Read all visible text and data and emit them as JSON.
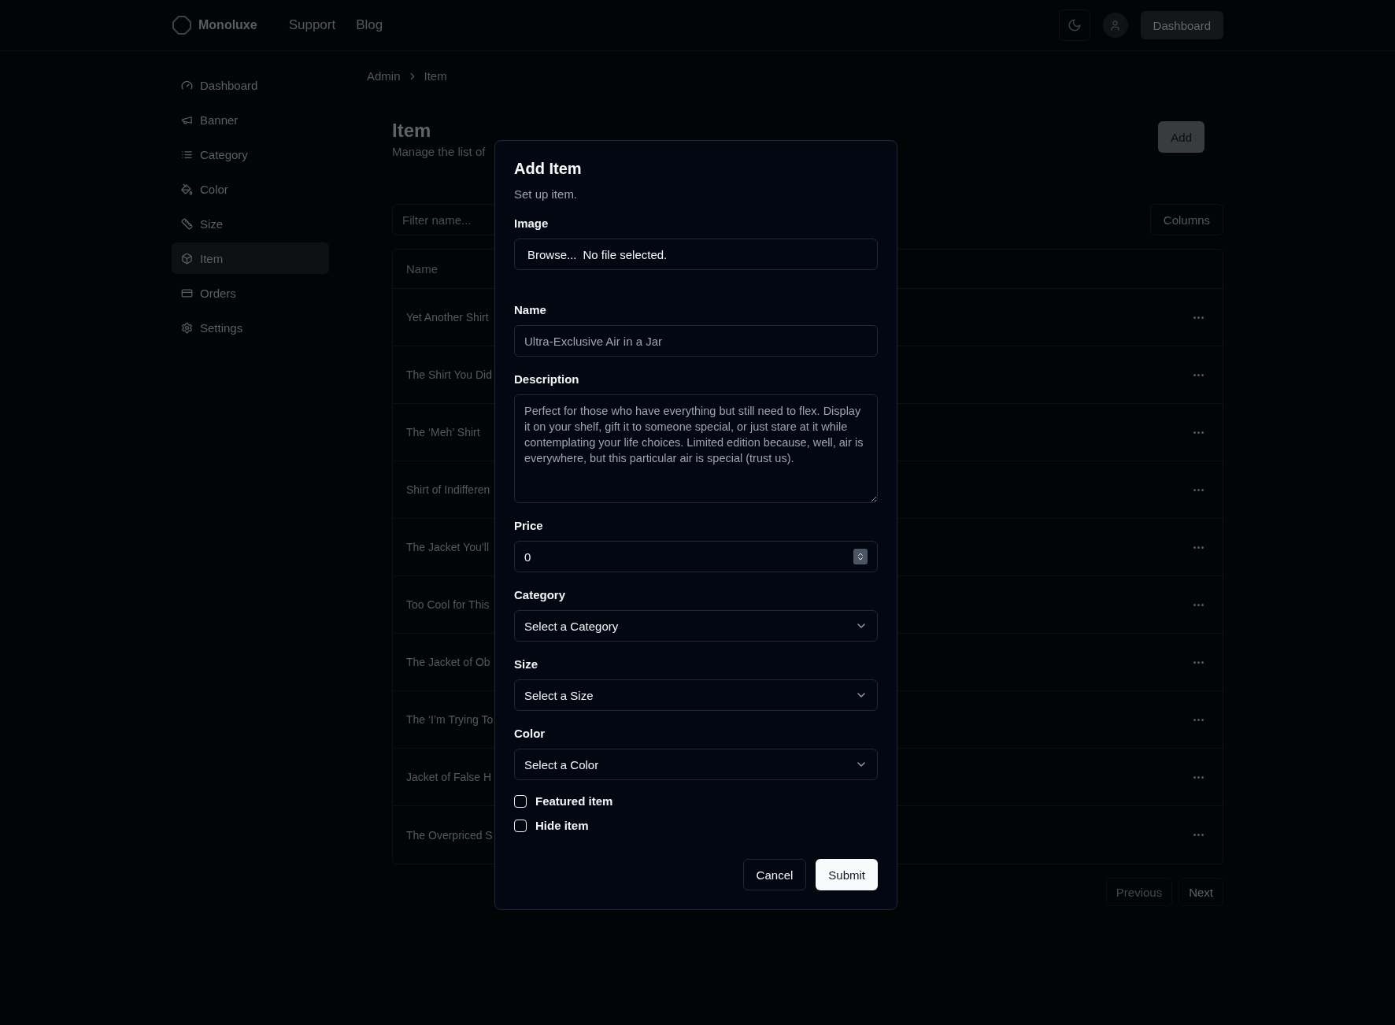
{
  "header": {
    "brand": "Monoluxe",
    "nav": [
      "Support",
      "Blog"
    ],
    "dashboard_button": "Dashboard"
  },
  "sidebar": {
    "items": [
      {
        "label": "Dashboard",
        "selected": false
      },
      {
        "label": "Banner",
        "selected": false
      },
      {
        "label": "Category",
        "selected": false
      },
      {
        "label": "Color",
        "selected": false
      },
      {
        "label": "Size",
        "selected": false
      },
      {
        "label": "Item",
        "selected": true
      },
      {
        "label": "Orders",
        "selected": false
      },
      {
        "label": "Settings",
        "selected": false
      }
    ]
  },
  "breadcrumb": [
    "Admin",
    "Item"
  ],
  "page": {
    "title": "Item",
    "subtitle": "Manage the list of",
    "add_button": "Add"
  },
  "filter": {
    "placeholder": "Filter name..."
  },
  "columns_button": "Columns",
  "table": {
    "columns": [
      "Name"
    ],
    "rows": [
      "Yet Another Shirt",
      "The Shirt You Did",
      "The ‘Meh’ Shirt",
      "Shirt of Indifferen",
      "The Jacket You’ll",
      "Too Cool for This",
      "The Jacket of Ob",
      "The ‘I’m Trying To",
      "Jacket of False H",
      "The Overpriced S"
    ]
  },
  "pagination": {
    "previous": "Previous",
    "next": "Next"
  },
  "dialog": {
    "title": "Add Item",
    "subtitle": "Set up item.",
    "fields": [
      {
        "kind": "file",
        "label": "Image",
        "button": "Browse...",
        "value": "No file selected."
      },
      {
        "kind": "text",
        "label": "Name",
        "placeholder": "Ultra-Exclusive Air in a Jar"
      },
      {
        "kind": "textarea",
        "label": "Description",
        "placeholder": "Perfect for those who have everything but still need to flex. Display it on your shelf, gift it to someone special, or just stare at it while contemplating your life choices. Limited edition because, well, air is everywhere, but this particular air is special (trust us)."
      },
      {
        "kind": "number",
        "label": "Price",
        "value": "0"
      },
      {
        "kind": "select",
        "label": "Category",
        "value": "Select a Category"
      },
      {
        "kind": "select",
        "label": "Size",
        "value": "Select a Size"
      },
      {
        "kind": "select",
        "label": "Color",
        "value": "Select a Color"
      }
    ],
    "checkboxes": [
      {
        "label": "Featured item",
        "checked": false
      },
      {
        "label": "Hide item",
        "checked": false
      }
    ],
    "buttons": {
      "cancel": "Cancel",
      "submit": "Submit"
    }
  }
}
